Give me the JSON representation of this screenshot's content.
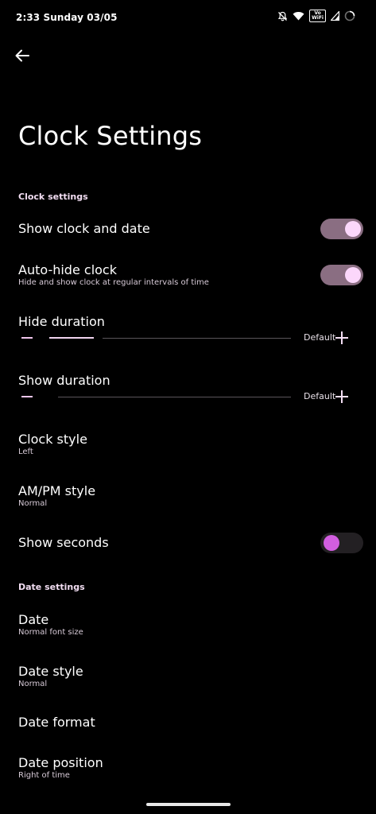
{
  "status_bar": {
    "time": "2:33 Sunday 03/05",
    "vowifi_top": "Vo",
    "vowifi_bottom": "WiFi",
    "icons": [
      "bell-off-icon",
      "wifi-icon",
      "vowifi-icon",
      "signal-icon",
      "battery-icon"
    ]
  },
  "header": {
    "back_icon": "arrow-left-icon",
    "title": "Clock Settings"
  },
  "sections": {
    "clock_header": "Clock settings",
    "date_header": "Date settings"
  },
  "clock": {
    "show_clock_and_date": {
      "title": "Show clock and date",
      "enabled": true
    },
    "auto_hide_clock": {
      "title": "Auto-hide clock",
      "subtitle": "Hide and show clock at regular intervals of time",
      "enabled": true
    },
    "hide_duration": {
      "title": "Hide duration",
      "default_label": "Default"
    },
    "show_duration": {
      "title": "Show duration",
      "default_label": "Default"
    },
    "clock_style": {
      "title": "Clock style",
      "value": "Left"
    },
    "ampm_style": {
      "title": "AM/PM style",
      "value": "Normal"
    },
    "show_seconds": {
      "title": "Show seconds",
      "enabled": false
    }
  },
  "date": {
    "date": {
      "title": "Date",
      "value": "Normal font size"
    },
    "date_style": {
      "title": "Date style",
      "value": "Normal"
    },
    "date_format": {
      "title": "Date format"
    },
    "date_position": {
      "title": "Date position",
      "value": "Right of time"
    }
  },
  "colors": {
    "background": "#000000",
    "toggle_on_track": "#8a6e82",
    "toggle_on_knob": "#fbd7fb",
    "toggle_off_knob": "#d25ee0",
    "accent_text": "#f2ddf2"
  }
}
